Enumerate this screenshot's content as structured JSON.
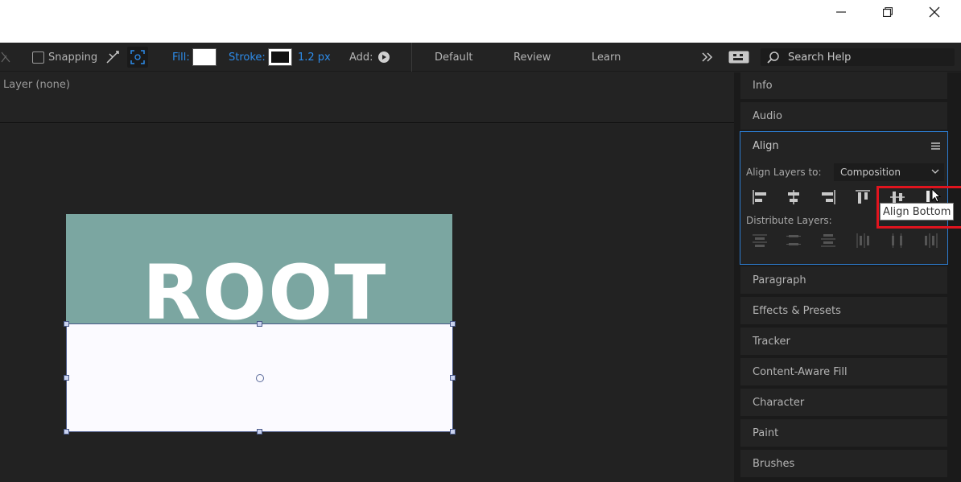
{
  "window": {
    "minimize_icon": "minimize-icon",
    "restore_icon": "restore-icon",
    "close_icon": "close-icon"
  },
  "toolbar": {
    "snapping_label": "Snapping",
    "fill_label": "Fill:",
    "stroke_label": "Stroke:",
    "stroke_width": "1.2 px",
    "add_label": "Add:",
    "workspaces": [
      "Default",
      "Review",
      "Learn"
    ],
    "overflow_icon": "double-chevron-right-icon",
    "fill_color": "#ffffff",
    "stroke_color": "#111111"
  },
  "search": {
    "placeholder": "Search Help"
  },
  "viewer": {
    "layer_label": "Layer (none)",
    "comp_text": "ROOT",
    "comp_bg_color": "#7ba6a1",
    "shape_color": "#fbfaff"
  },
  "panels": {
    "info": "Info",
    "audio": "Audio",
    "align": {
      "title": "Align",
      "align_layers_to_label": "Align Layers to:",
      "align_layers_to_value": "Composition",
      "distribute_label": "Distribute Layers:"
    },
    "paragraph": "Paragraph",
    "effects_presets": "Effects & Presets",
    "tracker": "Tracker",
    "content_aware_fill": "Content-Aware Fill",
    "character": "Character",
    "paint": "Paint",
    "brushes": "Brushes"
  },
  "tooltip": {
    "text": "Align Bottom"
  },
  "colors": {
    "accent_blue": "#2d8ceb",
    "highlight_red": "#e0141e",
    "panel_focus_border": "#2d7dd2"
  }
}
